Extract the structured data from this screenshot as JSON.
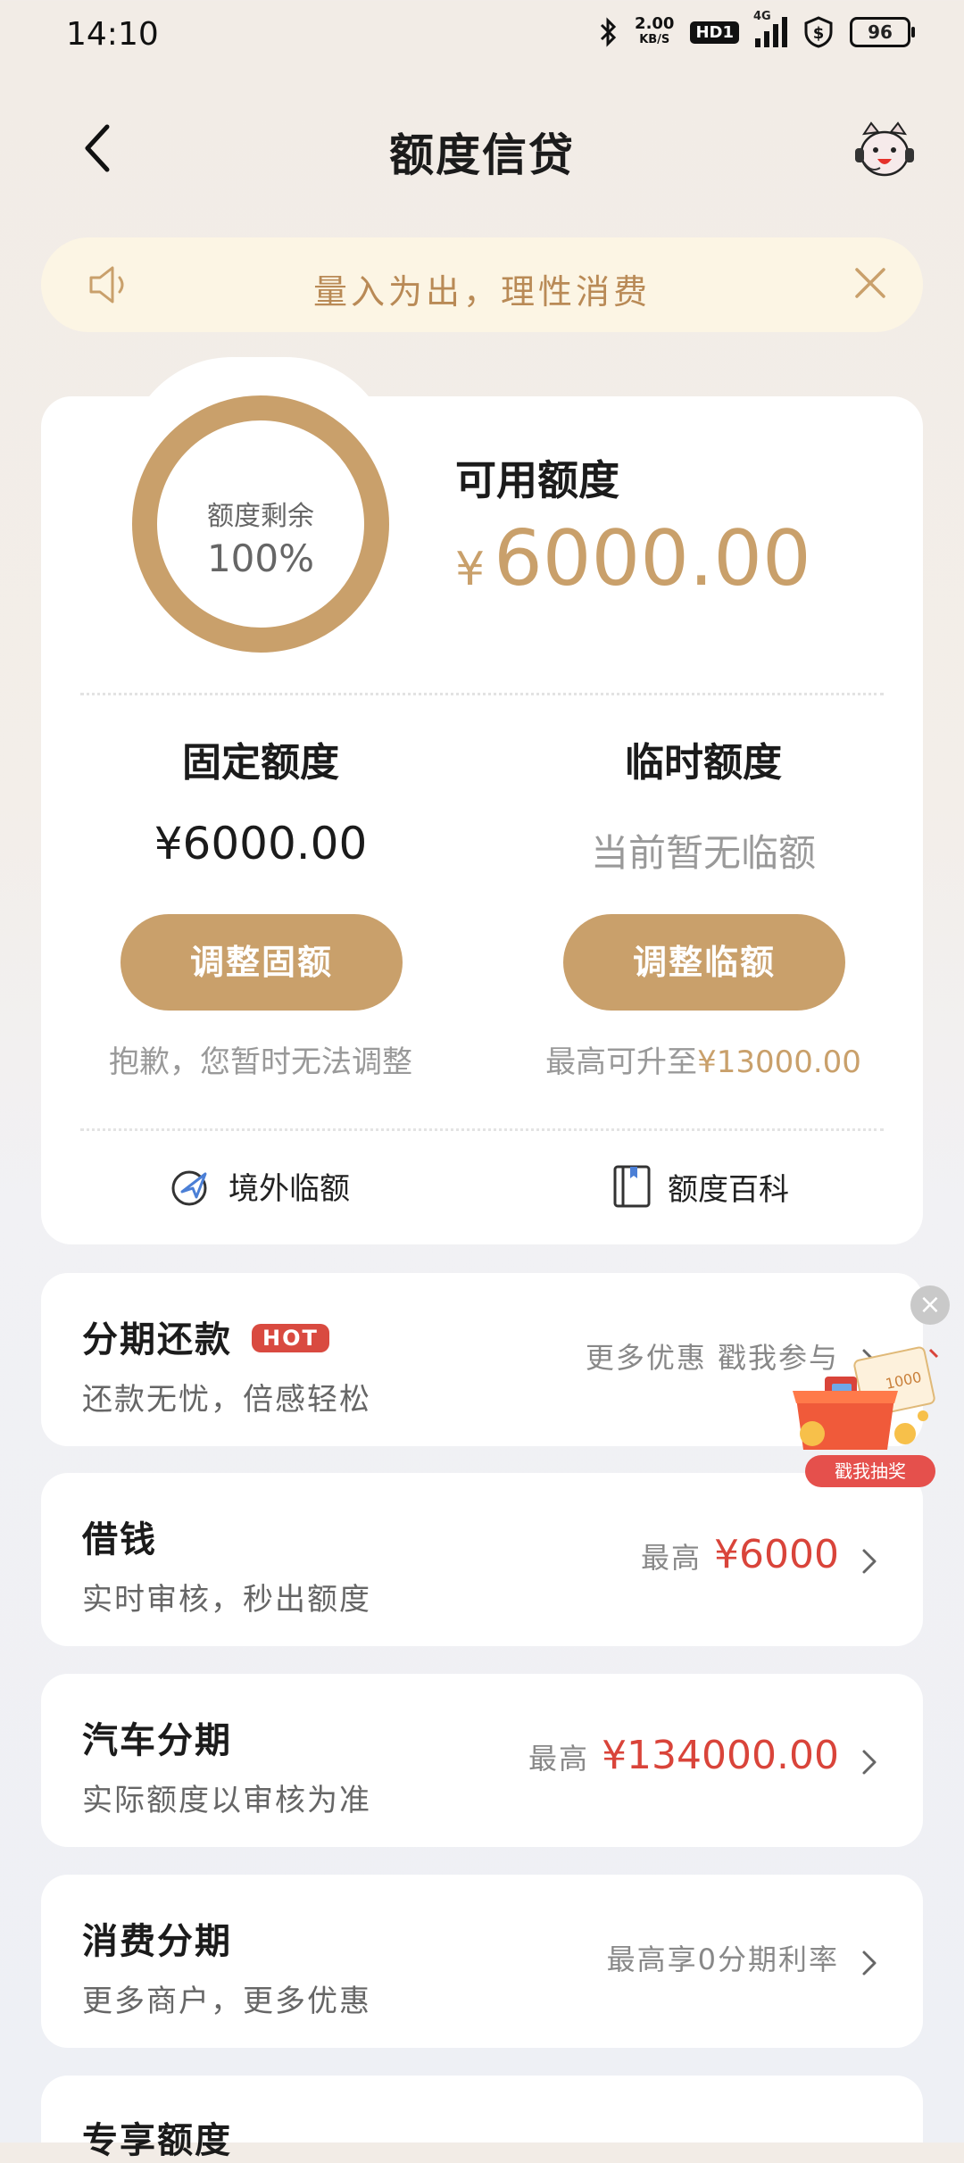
{
  "status_bar": {
    "time": "14:10",
    "net_speed_value": "2.00",
    "net_speed_unit": "KB/S",
    "hd": "HD1",
    "network": "4G",
    "battery": "96"
  },
  "header": {
    "title": "额度信贷"
  },
  "notice": {
    "text": "量入为出，理性消费"
  },
  "credit": {
    "ring_label": "额度剩余",
    "ring_percent": "100%",
    "remaining_fraction": 1.0,
    "available_label": "可用额度",
    "currency": "¥",
    "available_value": "6000.00",
    "fixed": {
      "title": "固定额度",
      "value": "¥6000.00",
      "button": "调整固额",
      "note": "抱歉，您暂时无法调整"
    },
    "temporary": {
      "title": "临时额度",
      "value": "当前暂无临额",
      "button": "调整临额",
      "note_prefix": "最高可升至",
      "note_amount": "¥13000.00"
    },
    "links": {
      "overseas": "境外临额",
      "wiki": "额度百科"
    }
  },
  "list": {
    "installment": {
      "title": "分期还款",
      "badge": "HOT",
      "desc": "还款无忧，倍感轻松",
      "right": "更多优惠 戳我参与"
    },
    "borrow": {
      "title": "借钱",
      "desc": "实时审核，秒出额度",
      "prefix": "最高",
      "amount": "¥6000"
    },
    "car": {
      "title": "汽车分期",
      "desc": "实际额度以审核为准",
      "prefix": "最高",
      "amount": "¥134000.00"
    },
    "consume": {
      "title": "消费分期",
      "desc": "更多商户，更多优惠",
      "right": "最高享0分期利率"
    },
    "exclusive": {
      "title": "专享额度"
    }
  },
  "promo": {
    "badge_amount": "1000",
    "button": "戳我抽奖"
  },
  "colors": {
    "gold": "#c9a06b",
    "red": "#d9443a",
    "notice_bg": "#fcf5e4"
  }
}
